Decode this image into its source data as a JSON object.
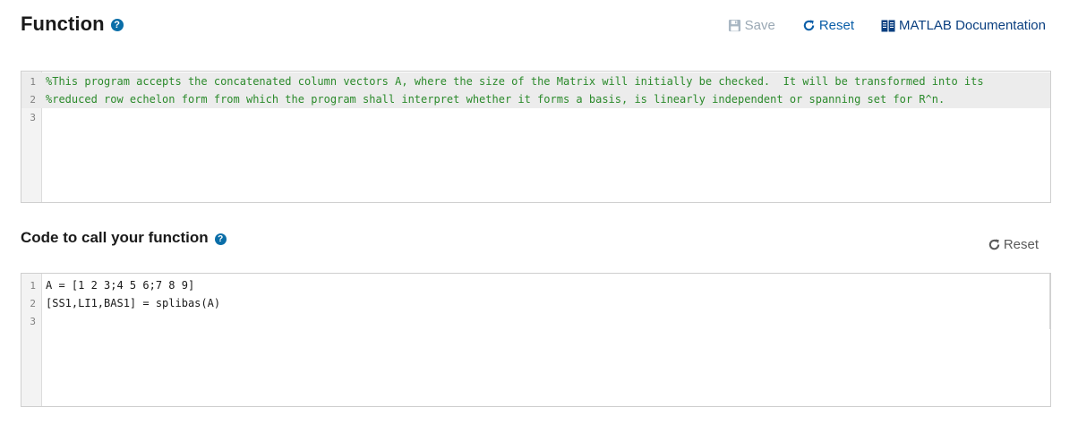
{
  "function_section": {
    "title": "Function",
    "help_icon": "question-circle-icon",
    "toolbar": {
      "save_label": "Save",
      "save_icon": "floppy-disk-icon",
      "reset_label": "Reset",
      "reset_icon": "refresh-icon",
      "docs_label": "MATLAB Documentation",
      "docs_icon": "book-icon"
    },
    "editor": {
      "lines": [
        {
          "number": "1",
          "text": "%This program accepts the concatenated column vectors A, where the size of the Matrix will initially be checked.  It will be transformed into its"
        },
        {
          "number": "2",
          "text": "%reduced row echelon form from which the program shall interpret whether it forms a basis, is linearly independent or spanning set for R^n."
        },
        {
          "number": "3",
          "text": ""
        }
      ]
    }
  },
  "call_section": {
    "title": "Code to call your function",
    "help_icon": "question-circle-icon",
    "reset_label": "Reset",
    "reset_icon": "refresh-icon",
    "editor": {
      "lines": [
        {
          "number": "1",
          "text": "A = [1 2 3;4 5 6;7 8 9]"
        },
        {
          "number": "2",
          "text": "[SS1,LI1,BAS1] = splibas(A)"
        },
        {
          "number": "3",
          "text": ""
        }
      ]
    }
  },
  "colors": {
    "accent": "#0a6ea8",
    "comment_green": "#2b8a2b",
    "disabled_gray": "#9aa8b4"
  }
}
